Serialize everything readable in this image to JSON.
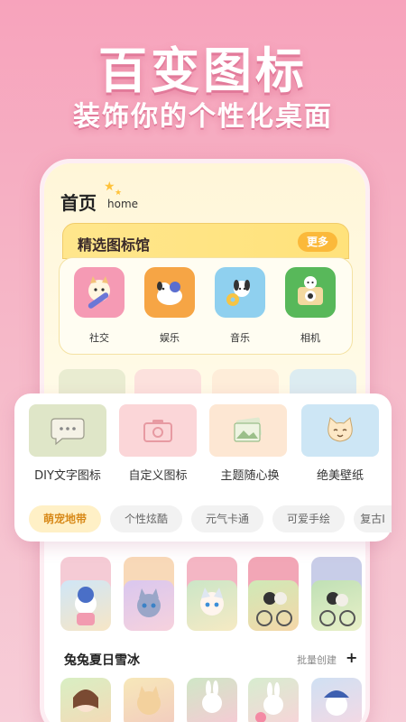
{
  "hero": {
    "title": "百变图标",
    "subtitle": "装饰你的个性化桌面"
  },
  "phone": {
    "home_title": "首页",
    "home_en": "home",
    "gallery": {
      "title": "精选图标馆",
      "more_label": "更多",
      "apps": [
        {
          "label": "社交",
          "icon": "social-cat-pencil-icon",
          "color": "#f59ab4"
        },
        {
          "label": "娱乐",
          "icon": "entertainment-dog-icon",
          "color": "#f6a545"
        },
        {
          "label": "音乐",
          "icon": "music-dog-icon",
          "color": "#8fd0ef"
        },
        {
          "label": "相机",
          "icon": "camera-cat-icon",
          "color": "#58b85a"
        }
      ]
    },
    "section": {
      "title": "兔兔夏日雪冰",
      "batch_label": "批量创建",
      "plus_label": "+"
    }
  },
  "features": {
    "tiles": [
      {
        "label": "DIY文字图标",
        "icon": "chat-bubble-icon",
        "color": "#dfe6c8"
      },
      {
        "label": "自定义图标",
        "icon": "camera-icon",
        "color": "#fbd6d8"
      },
      {
        "label": "主题随心换",
        "icon": "image-icon",
        "color": "#fde7d3"
      },
      {
        "label": "绝美壁纸",
        "icon": "cat-face-icon",
        "color": "#cde6f5"
      }
    ],
    "chips": [
      {
        "label": "萌宠地带",
        "active": true
      },
      {
        "label": "个性炫酷",
        "active": false
      },
      {
        "label": "元气卡通",
        "active": false
      },
      {
        "label": "可爱手绘",
        "active": false
      },
      {
        "label": "复古I",
        "active": false
      }
    ]
  },
  "colors": {
    "accent_pink": "#f7a3bc",
    "accent_yellow": "#fbb93a"
  }
}
